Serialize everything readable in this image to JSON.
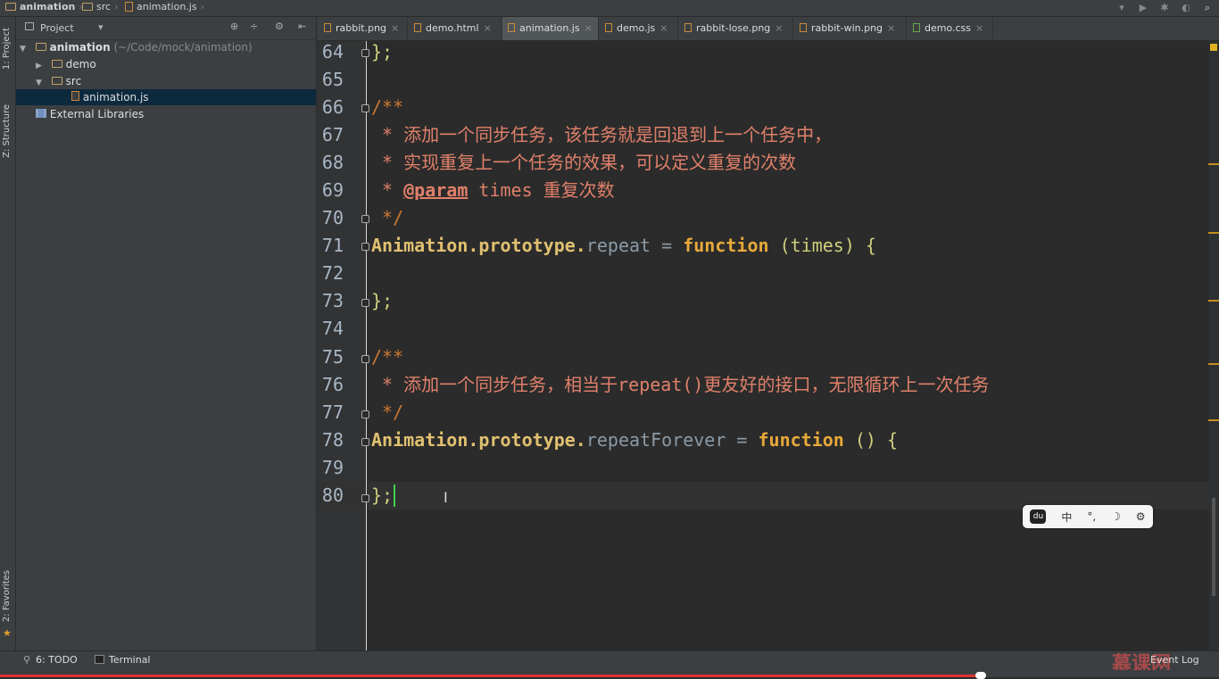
{
  "breadcrumb": {
    "project": "animation",
    "folder": "src",
    "file": "animation.js"
  },
  "toolstrip": {
    "project_label": "1: Project",
    "structure_label": "Z: Structure",
    "favorites_label": "2: Favorites"
  },
  "project_panel": {
    "header": "Project",
    "tree": [
      {
        "name": "animation",
        "path": "(~/Code/mock/animation)",
        "type": "folder",
        "expanded": true
      },
      {
        "name": "demo",
        "type": "folder",
        "expanded": false
      },
      {
        "name": "src",
        "type": "folder",
        "expanded": true
      },
      {
        "name": "animation.js",
        "type": "file",
        "selected": true
      },
      {
        "name": "External Libraries",
        "type": "library"
      }
    ]
  },
  "tabs": [
    {
      "label": "rabbit.png"
    },
    {
      "label": "demo.html"
    },
    {
      "label": "animation.js",
      "active": true
    },
    {
      "label": "demo.js"
    },
    {
      "label": "rabbit-lose.png"
    },
    {
      "label": "rabbit-win.png"
    },
    {
      "label": "demo.css"
    }
  ],
  "editor": {
    "lines": [
      {
        "n": "64",
        "text": "};"
      },
      {
        "n": "65",
        "text": ""
      },
      {
        "n": "66",
        "text": "/**"
      },
      {
        "n": "67",
        "text": " * 添加一个同步任务，该任务就是回退到上一个任务中，"
      },
      {
        "n": "68",
        "text": " * 实现重复上一个任务的效果，可以定义重复的次数"
      },
      {
        "n": "69a",
        "text": " * "
      },
      {
        "n": "69b",
        "text": "@param"
      },
      {
        "n": "69c",
        "text": " times 重复次数"
      },
      {
        "n": "70",
        "text": " */"
      },
      {
        "n": "71_obj",
        "text": "Animation"
      },
      {
        "n": "71_proto",
        "text": ".prototype."
      },
      {
        "n": "71_prop",
        "text": "repeat"
      },
      {
        "n": "71_eq",
        "text": " = "
      },
      {
        "n": "71_kw",
        "text": "function"
      },
      {
        "n": "71_rest",
        "text": " (times) {"
      },
      {
        "n": "72",
        "text": ""
      },
      {
        "n": "73",
        "text": "};"
      },
      {
        "n": "74",
        "text": ""
      },
      {
        "n": "75",
        "text": "/**"
      },
      {
        "n": "76",
        "text": " * 添加一个同步任务，相当于repeat()更友好的接口，无限循环上一次任务"
      },
      {
        "n": "77",
        "text": " */"
      },
      {
        "n": "78_obj",
        "text": "Animation"
      },
      {
        "n": "78_proto",
        "text": ".prototype."
      },
      {
        "n": "78_prop",
        "text": "repeatForever"
      },
      {
        "n": "78_eq",
        "text": " = "
      },
      {
        "n": "78_kw",
        "text": "function"
      },
      {
        "n": "78_rest",
        "text": " () {"
      },
      {
        "n": "79",
        "text": ""
      },
      {
        "n": "80",
        "text": "};"
      }
    ],
    "line_numbers": [
      "64",
      "65",
      "66",
      "67",
      "68",
      "69",
      "70",
      "71",
      "72",
      "73",
      "74",
      "75",
      "76",
      "77",
      "78",
      "79",
      "80"
    ]
  },
  "ime": {
    "mode": "中",
    "punct": "°,",
    "moon": "☽",
    "gear": "⚙"
  },
  "bottom": {
    "todo": "6: TODO",
    "terminal": "Terminal",
    "event_log": "Event Log",
    "watermark": "慕课网"
  },
  "colors": {
    "comment": "#cc7832",
    "doc": "#e0806a",
    "keyword": "#e8a93a",
    "caret": "#39d353"
  }
}
